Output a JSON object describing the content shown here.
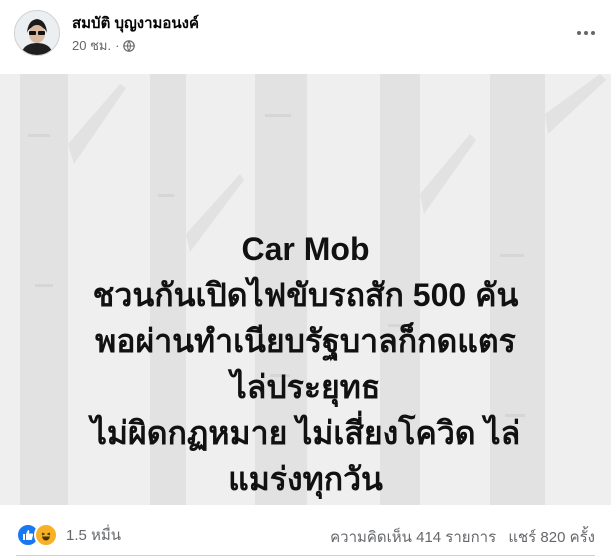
{
  "post": {
    "author": "สมบัติ บุญงามอนงค์",
    "time": "20 ชม.",
    "privacy_icon": "globe-icon",
    "more_icon": "more-options-icon"
  },
  "image_text": {
    "lines": [
      "Car Mob",
      "ชวนกันเปิดไฟขับรถสัก 500 คัน",
      "พอผ่านทำเนียบรัฐบาลก็กดแตร",
      "ไล่ประยุทธ",
      "ไม่ผิดกฏหมาย ไม่เสี่ยงโควิด ไล่",
      "แมร่งทุกวัน"
    ]
  },
  "footer": {
    "reaction_icons": [
      "like-icon",
      "haha-icon"
    ],
    "reaction_count": "1.5 หมื่น",
    "comments": "ความคิดเห็น 414 รายการ",
    "shares": "แชร์ 820 ครั้ง"
  },
  "colors": {
    "accent": "#1877f2",
    "haha": "#f7b125",
    "secondary_text": "#65676b",
    "image_bg": "#efefef"
  }
}
